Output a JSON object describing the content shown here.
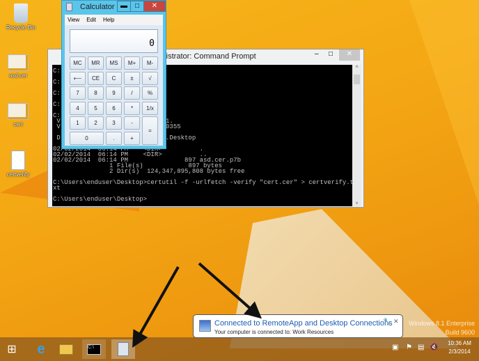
{
  "desktop_icons": [
    {
      "label": "Recycle Bin",
      "icon": "recycle-bin-icon"
    },
    {
      "label": "asd.cer",
      "icon": "certificate-icon"
    },
    {
      "label": "cert",
      "icon": "certificate-icon"
    },
    {
      "label": "certverify",
      "icon": "text-file-icon"
    }
  ],
  "calculator": {
    "title": "Calculator",
    "menu": [
      "View",
      "Edit",
      "Help"
    ],
    "display": "0",
    "keys": [
      "MC",
      "MR",
      "MS",
      "M+",
      "M-",
      "⟵",
      "CE",
      "C",
      "±",
      "√",
      "7",
      "8",
      "9",
      "/",
      "%",
      "4",
      "5",
      "6",
      "*",
      "1/x",
      "1",
      "2",
      "3",
      "-",
      "=",
      "0",
      ".",
      "+"
    ]
  },
  "cmd": {
    "title": "Administrator: Command Prompt",
    "visible_title": "ninistrator: Command Prompt",
    "lines": [
      "C:",
      "",
      "C:",
      "",
      "C:",
      "",
      "C:",
      "",
      "C:",
      " V                            1.",
      " V                            0355",
      "",
      " D                            .Desktop",
      "",
      "02/02/2014  06:14 PM    <DIR>          .",
      "02/02/2014  06:14 PM    <DIR>          ..",
      "02/02/2014  06:14 PM               897 asd.cer.p7b",
      "               1 File(s)            897 bytes",
      "               2 Dir(s)  124,347,895,808 bytes free",
      "",
      "C:\\Users\\enduser\\Desktop>certutil -f -urlfetch -verify \"cert.cer\" > certverify.t",
      "xt",
      "",
      "C:\\Users\\enduser\\Desktop>"
    ]
  },
  "notification": {
    "title": "Connected to RemoteApp and Desktop Connections",
    "message": "Your computer is connected to: Work Resources"
  },
  "watermark": {
    "line1": "Windows 8.1 Enterprise",
    "line2": "Build 9600"
  },
  "clock": {
    "time": "10:36 AM",
    "date": "2/3/2014"
  }
}
